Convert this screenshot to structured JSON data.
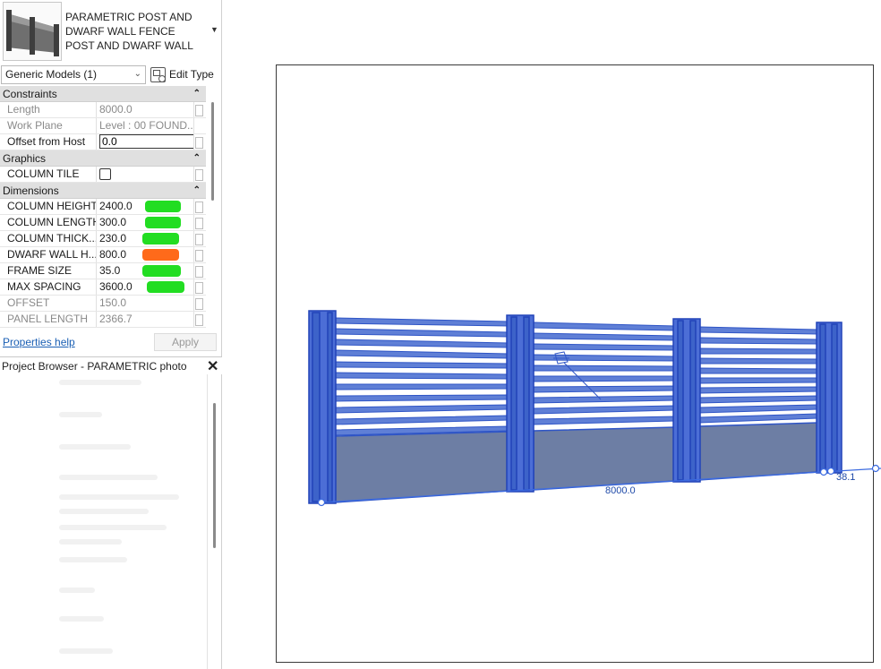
{
  "type_selector": {
    "family_line1": "PARAMETRIC POST AND",
    "family_line2": "DWARF WALL FENCE",
    "type_line": "POST AND DWARF WALL",
    "icon": "chevron-down-icon"
  },
  "instance_filter": {
    "selected": "Generic Models (1)",
    "edit_type_label": "Edit Type"
  },
  "groups": {
    "constraints": "Constraints",
    "graphics": "Graphics",
    "dimensions": "Dimensions"
  },
  "constraints": [
    {
      "name": "Length",
      "value": "8000.0"
    },
    {
      "name": "Work Plane",
      "value": "Level : 00 FOUND..."
    },
    {
      "name": "Offset from Host",
      "value": "0.0"
    }
  ],
  "graphics": [
    {
      "name": "COLUMN TILE",
      "checked": false
    }
  ],
  "dimensions": [
    {
      "name": "COLUMN HEIGHT",
      "value": "2400.0",
      "highlight": "#22dd22"
    },
    {
      "name": "COLUMN LENGTH",
      "value": "300.0",
      "highlight": "#22dd22"
    },
    {
      "name": "COLUMN THICK...",
      "value": "230.0",
      "highlight": "#22dd22"
    },
    {
      "name": "DWARF WALL H...",
      "value": "800.0",
      "highlight": "#ff6a1a"
    },
    {
      "name": "FRAME SIZE",
      "value": "35.0",
      "highlight": "#22dd22"
    },
    {
      "name": "MAX SPACING",
      "value": "3600.0",
      "highlight": "#22dd22"
    },
    {
      "name": "OFFSET",
      "value": "150.0"
    },
    {
      "name": "PANEL LENGTH",
      "value": "2366.7"
    }
  ],
  "footer": {
    "help_link": "Properties help",
    "apply_label": "Apply"
  },
  "project_browser": {
    "title": "Project Browser - PARAMETRIC photo",
    "close_icon": "close-icon"
  },
  "viewport": {
    "length_dimension": "8000.0",
    "side_dimension": "38.1",
    "fence_color": "#3d63c9",
    "wall_color": "#6d7ea4"
  }
}
